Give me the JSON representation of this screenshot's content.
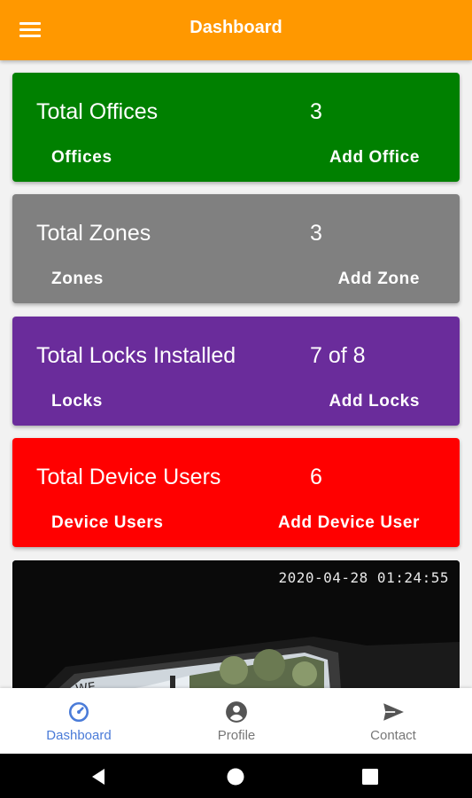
{
  "appbar": {
    "title": "Dashboard",
    "menu_icon": "hamburger-menu-icon",
    "color": "#ff9800"
  },
  "cards": [
    {
      "label": "Total Offices",
      "value": "3",
      "left_link": "Offices",
      "right_link": "Add Office",
      "color": "#008000"
    },
    {
      "label": "Total Zones",
      "value": "3",
      "left_link": "Zones",
      "right_link": "Add Zone",
      "color": "#808080"
    },
    {
      "label": "Total Locks Installed",
      "value": "7 of 8",
      "left_link": "Locks",
      "right_link": "Add Locks",
      "color": "#6a2c9b"
    },
    {
      "label": "Total Device Users",
      "value": "6",
      "left_link": "Device Users",
      "right_link": "Add Device User",
      "color": "#ff0000"
    }
  ],
  "camera": {
    "timestamp": "2020-04-28 01:24:55"
  },
  "bottom_nav": [
    {
      "label": "Dashboard",
      "icon": "speedometer-icon",
      "active": true
    },
    {
      "label": "Profile",
      "icon": "account-circle-icon",
      "active": false
    },
    {
      "label": "Contact",
      "icon": "send-icon",
      "active": false
    }
  ],
  "system_nav": {
    "icons": [
      "back-icon",
      "home-icon",
      "recents-icon"
    ]
  },
  "colors": {
    "active_nav": "#4a7bd8",
    "inactive_nav": "#777777"
  }
}
